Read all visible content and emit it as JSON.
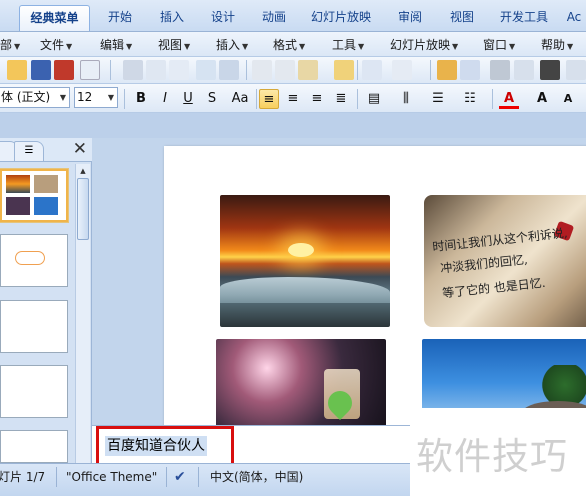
{
  "ribbon_tabs": [
    {
      "label": "经典菜单",
      "active": true
    },
    {
      "label": "开始"
    },
    {
      "label": "插入"
    },
    {
      "label": "设计"
    },
    {
      "label": "动画"
    },
    {
      "label": "幻灯片放映"
    },
    {
      "label": "审阅"
    },
    {
      "label": "视图"
    },
    {
      "label": "开发工具"
    },
    {
      "label": "Ac"
    }
  ],
  "classic_menu": [
    {
      "label": "部"
    },
    {
      "label": "文件"
    },
    {
      "label": "编辑"
    },
    {
      "label": "视图"
    },
    {
      "label": "插入"
    },
    {
      "label": "格式"
    },
    {
      "label": "工具"
    },
    {
      "label": "幻灯片放映"
    },
    {
      "label": "窗口"
    },
    {
      "label": "帮助"
    }
  ],
  "format_toolbar": {
    "font_name": "体 (正文)",
    "font_size": "12",
    "bold": "B",
    "italic": "I",
    "underline": "U",
    "shadow": "S",
    "change_case": "Aa"
  },
  "notes": {
    "text": "百度知道合伙人"
  },
  "statusbar": {
    "slide_info": "灯片 1/7",
    "theme": "\"Office Theme\"",
    "language": "中文(简体，中国)"
  },
  "photos": {
    "note_lines": [
      "时间让我们从这个利诉说,",
      "冲淡我们的回忆,",
      "等了它的 也是日忆."
    ]
  },
  "watermark": "软件技巧",
  "colors": {
    "accent": "#15428b",
    "highlight_border": "#d80f0f",
    "selected_thumb": "#f0b44a"
  }
}
